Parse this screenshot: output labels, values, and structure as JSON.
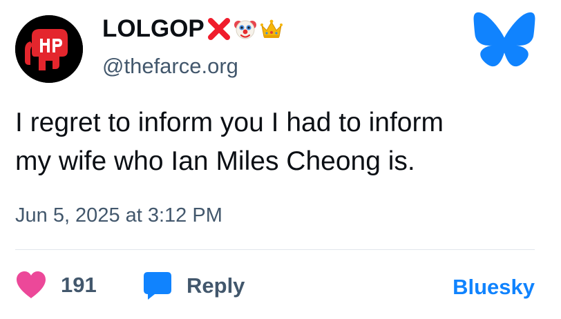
{
  "author": {
    "display_name": "LOLGOP",
    "handle": "@thefarce.org",
    "name_emojis": [
      "cross-mark-icon",
      "clown-face-icon",
      "crown-icon"
    ]
  },
  "post": {
    "text_lines": [
      "I regret to inform you I had to inform",
      "my wife who Ian Miles Cheong is."
    ],
    "timestamp": "Jun 5, 2025 at 3:12 PM"
  },
  "actions": {
    "like_count": "191",
    "reply_label": "Reply",
    "platform_link": "Bluesky"
  },
  "colors": {
    "brand_blue": "#1083fe",
    "like_pink": "#ec4899",
    "muted_text": "#42576c",
    "avatar_red": "#e4262d"
  }
}
